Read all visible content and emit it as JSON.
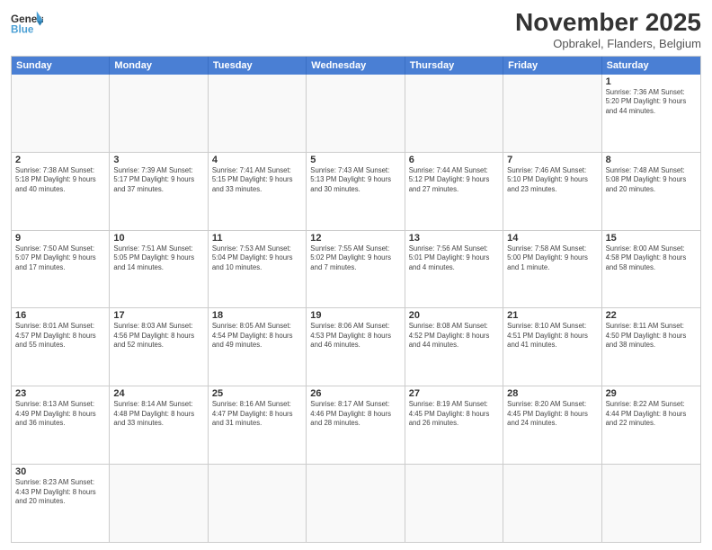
{
  "header": {
    "logo_general": "General",
    "logo_blue": "Blue",
    "title": "November 2025",
    "subtitle": "Opbrakel, Flanders, Belgium"
  },
  "weekdays": [
    "Sunday",
    "Monday",
    "Tuesday",
    "Wednesday",
    "Thursday",
    "Friday",
    "Saturday"
  ],
  "rows": [
    [
      {
        "day": "",
        "info": ""
      },
      {
        "day": "",
        "info": ""
      },
      {
        "day": "",
        "info": ""
      },
      {
        "day": "",
        "info": ""
      },
      {
        "day": "",
        "info": ""
      },
      {
        "day": "",
        "info": ""
      },
      {
        "day": "1",
        "info": "Sunrise: 7:36 AM\nSunset: 5:20 PM\nDaylight: 9 hours\nand 44 minutes."
      }
    ],
    [
      {
        "day": "2",
        "info": "Sunrise: 7:38 AM\nSunset: 5:18 PM\nDaylight: 9 hours\nand 40 minutes."
      },
      {
        "day": "3",
        "info": "Sunrise: 7:39 AM\nSunset: 5:17 PM\nDaylight: 9 hours\nand 37 minutes."
      },
      {
        "day": "4",
        "info": "Sunrise: 7:41 AM\nSunset: 5:15 PM\nDaylight: 9 hours\nand 33 minutes."
      },
      {
        "day": "5",
        "info": "Sunrise: 7:43 AM\nSunset: 5:13 PM\nDaylight: 9 hours\nand 30 minutes."
      },
      {
        "day": "6",
        "info": "Sunrise: 7:44 AM\nSunset: 5:12 PM\nDaylight: 9 hours\nand 27 minutes."
      },
      {
        "day": "7",
        "info": "Sunrise: 7:46 AM\nSunset: 5:10 PM\nDaylight: 9 hours\nand 23 minutes."
      },
      {
        "day": "8",
        "info": "Sunrise: 7:48 AM\nSunset: 5:08 PM\nDaylight: 9 hours\nand 20 minutes."
      }
    ],
    [
      {
        "day": "9",
        "info": "Sunrise: 7:50 AM\nSunset: 5:07 PM\nDaylight: 9 hours\nand 17 minutes."
      },
      {
        "day": "10",
        "info": "Sunrise: 7:51 AM\nSunset: 5:05 PM\nDaylight: 9 hours\nand 14 minutes."
      },
      {
        "day": "11",
        "info": "Sunrise: 7:53 AM\nSunset: 5:04 PM\nDaylight: 9 hours\nand 10 minutes."
      },
      {
        "day": "12",
        "info": "Sunrise: 7:55 AM\nSunset: 5:02 PM\nDaylight: 9 hours\nand 7 minutes."
      },
      {
        "day": "13",
        "info": "Sunrise: 7:56 AM\nSunset: 5:01 PM\nDaylight: 9 hours\nand 4 minutes."
      },
      {
        "day": "14",
        "info": "Sunrise: 7:58 AM\nSunset: 5:00 PM\nDaylight: 9 hours\nand 1 minute."
      },
      {
        "day": "15",
        "info": "Sunrise: 8:00 AM\nSunset: 4:58 PM\nDaylight: 8 hours\nand 58 minutes."
      }
    ],
    [
      {
        "day": "16",
        "info": "Sunrise: 8:01 AM\nSunset: 4:57 PM\nDaylight: 8 hours\nand 55 minutes."
      },
      {
        "day": "17",
        "info": "Sunrise: 8:03 AM\nSunset: 4:56 PM\nDaylight: 8 hours\nand 52 minutes."
      },
      {
        "day": "18",
        "info": "Sunrise: 8:05 AM\nSunset: 4:54 PM\nDaylight: 8 hours\nand 49 minutes."
      },
      {
        "day": "19",
        "info": "Sunrise: 8:06 AM\nSunset: 4:53 PM\nDaylight: 8 hours\nand 46 minutes."
      },
      {
        "day": "20",
        "info": "Sunrise: 8:08 AM\nSunset: 4:52 PM\nDaylight: 8 hours\nand 44 minutes."
      },
      {
        "day": "21",
        "info": "Sunrise: 8:10 AM\nSunset: 4:51 PM\nDaylight: 8 hours\nand 41 minutes."
      },
      {
        "day": "22",
        "info": "Sunrise: 8:11 AM\nSunset: 4:50 PM\nDaylight: 8 hours\nand 38 minutes."
      }
    ],
    [
      {
        "day": "23",
        "info": "Sunrise: 8:13 AM\nSunset: 4:49 PM\nDaylight: 8 hours\nand 36 minutes."
      },
      {
        "day": "24",
        "info": "Sunrise: 8:14 AM\nSunset: 4:48 PM\nDaylight: 8 hours\nand 33 minutes."
      },
      {
        "day": "25",
        "info": "Sunrise: 8:16 AM\nSunset: 4:47 PM\nDaylight: 8 hours\nand 31 minutes."
      },
      {
        "day": "26",
        "info": "Sunrise: 8:17 AM\nSunset: 4:46 PM\nDaylight: 8 hours\nand 28 minutes."
      },
      {
        "day": "27",
        "info": "Sunrise: 8:19 AM\nSunset: 4:45 PM\nDaylight: 8 hours\nand 26 minutes."
      },
      {
        "day": "28",
        "info": "Sunrise: 8:20 AM\nSunset: 4:45 PM\nDaylight: 8 hours\nand 24 minutes."
      },
      {
        "day": "29",
        "info": "Sunrise: 8:22 AM\nSunset: 4:44 PM\nDaylight: 8 hours\nand 22 minutes."
      }
    ],
    [
      {
        "day": "30",
        "info": "Sunrise: 8:23 AM\nSunset: 4:43 PM\nDaylight: 8 hours\nand 20 minutes."
      },
      {
        "day": "",
        "info": ""
      },
      {
        "day": "",
        "info": ""
      },
      {
        "day": "",
        "info": ""
      },
      {
        "day": "",
        "info": ""
      },
      {
        "day": "",
        "info": ""
      },
      {
        "day": "",
        "info": ""
      }
    ]
  ]
}
